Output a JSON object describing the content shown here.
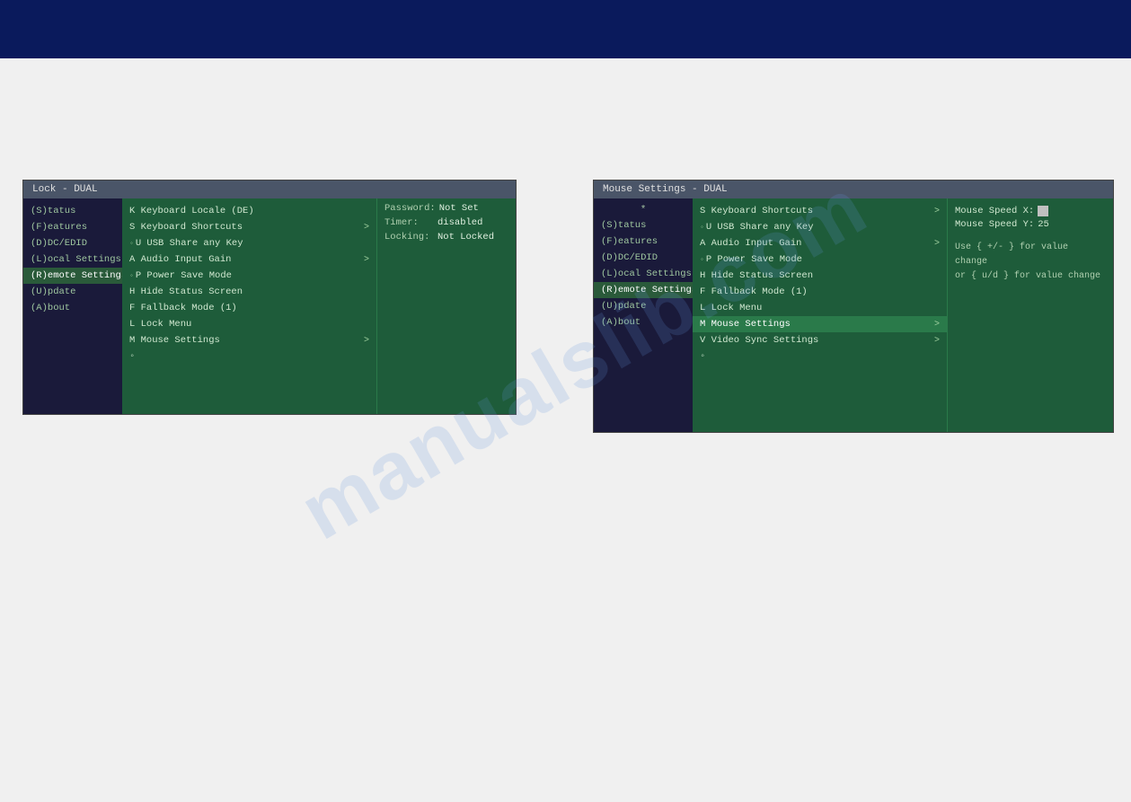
{
  "top_bar": {
    "color": "#0a1a5c"
  },
  "watermark": {
    "text": "manualslib.com"
  },
  "left_panel": {
    "title": "Lock - DUAL",
    "sidebar_items": [
      {
        "label": "(S)tatus",
        "active": false
      },
      {
        "label": "(F)eatures",
        "active": false
      },
      {
        "label": "(D)DC/EDID",
        "active": false
      },
      {
        "label": "(L)ocal  Settings",
        "active": false
      },
      {
        "label": "(R)emote Settings",
        "active": true
      },
      {
        "label": "(U)pdate",
        "active": false
      },
      {
        "label": "(A)bout",
        "active": false
      }
    ],
    "menu_items": [
      {
        "label": "K Keyboard Locale (DE)",
        "has_arrow": false,
        "has_dot": false
      },
      {
        "label": "S Keyboard Shortcuts",
        "has_arrow": true,
        "has_dot": false
      },
      {
        "label": "U USB Share any Key",
        "has_arrow": false,
        "has_dot": true
      },
      {
        "label": "A Audio Input Gain",
        "has_arrow": true,
        "has_dot": false
      },
      {
        "label": "P Power Save Mode",
        "has_arrow": false,
        "has_dot": true
      },
      {
        "label": "H Hide Status Screen",
        "has_arrow": false,
        "has_dot": false
      },
      {
        "label": "F Fallback Mode (1)",
        "has_arrow": false,
        "has_dot": false
      },
      {
        "label": "L Lock Menu",
        "has_arrow": false,
        "has_dot": false
      },
      {
        "label": "M Mouse Settings",
        "has_arrow": true,
        "has_dot": false
      },
      {
        "label": "•",
        "has_arrow": false,
        "has_dot": false,
        "is_dot_only": true
      }
    ],
    "info_rows": [
      {
        "label": "Password:",
        "value": "Not Set"
      },
      {
        "label": "Timer:",
        "value": "disabled"
      },
      {
        "label": "Locking:",
        "value": "Not Locked"
      }
    ]
  },
  "right_panel": {
    "title": "Mouse Settings - DUAL",
    "asterisk_top": "*",
    "sidebar_items": [
      {
        "label": "(S)tatus",
        "active": false
      },
      {
        "label": "(F)eatures",
        "active": false
      },
      {
        "label": "(D)DC/EDID",
        "active": false
      },
      {
        "label": "(L)ocal  Settings",
        "active": false
      },
      {
        "label": "(R)emote Settings",
        "active": true
      },
      {
        "label": "(U)pdate",
        "active": false
      },
      {
        "label": "(A)bout",
        "active": false
      }
    ],
    "menu_items": [
      {
        "label": "S Keyboard Shortcuts",
        "has_arrow": true,
        "has_dot": false
      },
      {
        "label": "U USB Share any Key",
        "has_arrow": false,
        "has_dot": true
      },
      {
        "label": "A Audio Input Gain",
        "has_arrow": true,
        "has_dot": false
      },
      {
        "label": "P Power Save Mode",
        "has_arrow": false,
        "has_dot": true
      },
      {
        "label": "H Hide Status Screen",
        "has_arrow": false,
        "has_dot": false
      },
      {
        "label": "F Fallback Mode (1)",
        "has_arrow": false,
        "has_dot": false
      },
      {
        "label": "L Lock Menu",
        "has_arrow": false,
        "has_dot": false
      },
      {
        "label": "M Mouse Settings",
        "has_arrow": true,
        "has_dot": false,
        "active": true
      },
      {
        "label": "V Video Sync Settings",
        "has_arrow": true,
        "has_dot": false
      },
      {
        "label": "•",
        "has_arrow": false,
        "has_dot": false,
        "is_dot_only": true
      }
    ],
    "mouse_speed": {
      "speed_x_label": "Mouse Speed X:",
      "speed_x_value": "",
      "speed_y_label": "Mouse Speed Y:",
      "speed_y_value": "25"
    },
    "help_text_line1": "Use { +/- } for value change",
    "help_text_line2": "or  { u/d } for value change",
    "asterisk_bottom": "•"
  }
}
